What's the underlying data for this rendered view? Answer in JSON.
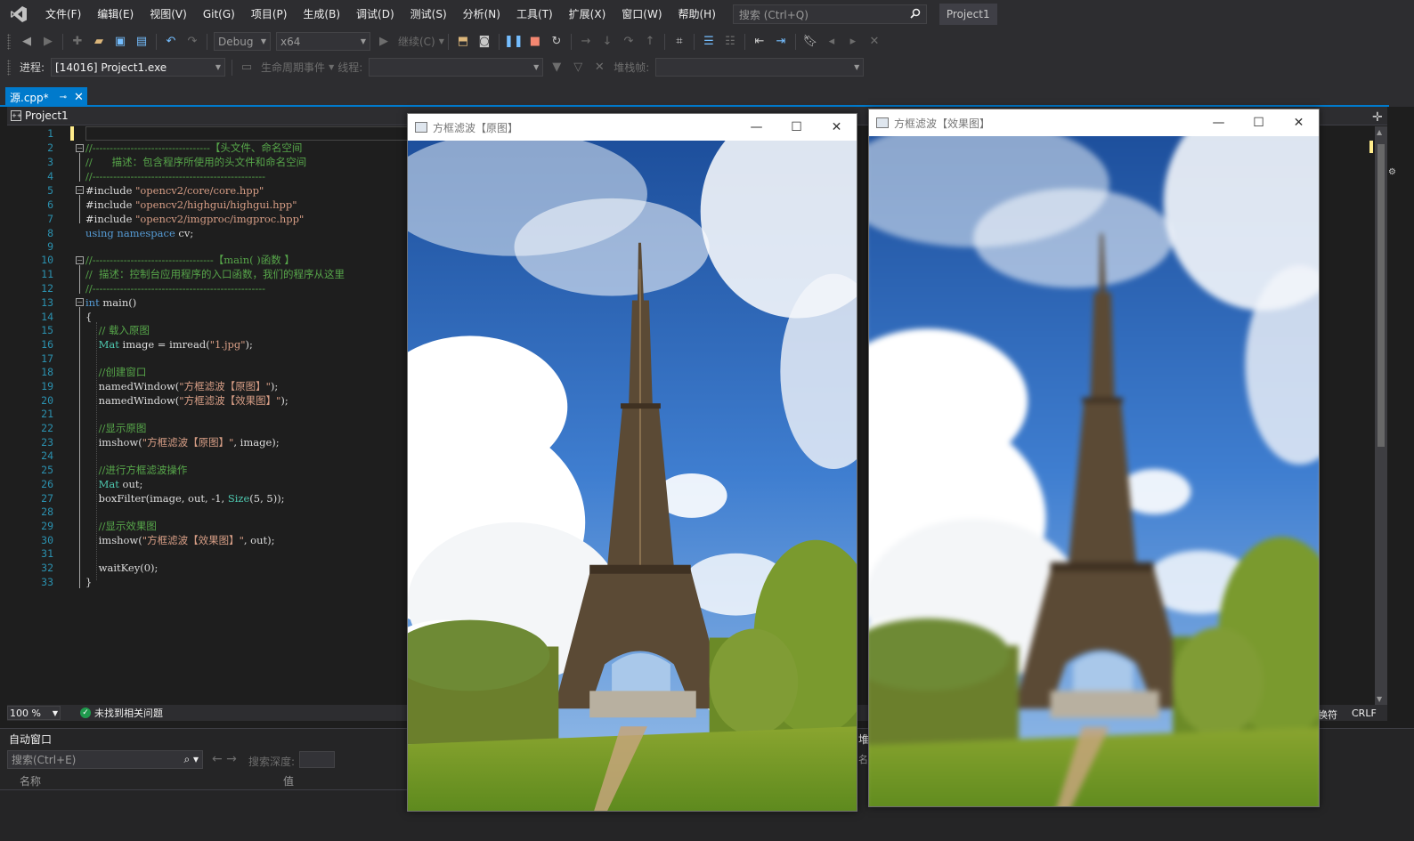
{
  "menu": {
    "items": [
      "文件(F)",
      "编辑(E)",
      "视图(V)",
      "Git(G)",
      "项目(P)",
      "生成(B)",
      "调试(D)",
      "测试(S)",
      "分析(N)",
      "工具(T)",
      "扩展(X)",
      "窗口(W)",
      "帮助(H)"
    ],
    "search_placeholder": "搜索 (Ctrl+Q)",
    "project_title": "Project1"
  },
  "toolbar": {
    "config": "Debug",
    "platform": "x64",
    "continue_label": "继续(C)",
    "process_label": "进程:",
    "process_value": "[14016] Project1.exe",
    "lifecycle_label": "生命周期事件",
    "thread_label": "线程:",
    "stackframe_label": "堆栈帧:"
  },
  "tabs": {
    "active_tab": "源.cpp*",
    "nav_project": "Project1"
  },
  "editor": {
    "line_numbers": [
      "1",
      "2",
      "3",
      "4",
      "5",
      "6",
      "7",
      "8",
      "9",
      "10",
      "11",
      "12",
      "13",
      "14",
      "15",
      "16",
      "17",
      "18",
      "19",
      "20",
      "21",
      "22",
      "23",
      "24",
      "25",
      "26",
      "27",
      "28",
      "29",
      "30",
      "31",
      "32",
      "33"
    ],
    "zoom": "100 %",
    "issues_text": "未找到相关问题",
    "line_ending": "CRLF",
    "encoding_fragment": "换符"
  },
  "autos": {
    "title": "自动窗口",
    "search_placeholder": "搜索(Ctrl+E)",
    "depth_label": "搜索深度:",
    "col_name": "名称",
    "col_value": "值"
  },
  "right_panel": {
    "label": "堆",
    "label2": "名称"
  },
  "windows": {
    "original_title": "方框滤波【原图】",
    "effect_title": "方框滤波【效果图】"
  },
  "colors": {
    "accent": "#007acc",
    "comment": "#57a64a",
    "keyword": "#569cd6",
    "string": "#d69d85",
    "type": "#4ec9b0",
    "line_number": "#2b91af"
  }
}
